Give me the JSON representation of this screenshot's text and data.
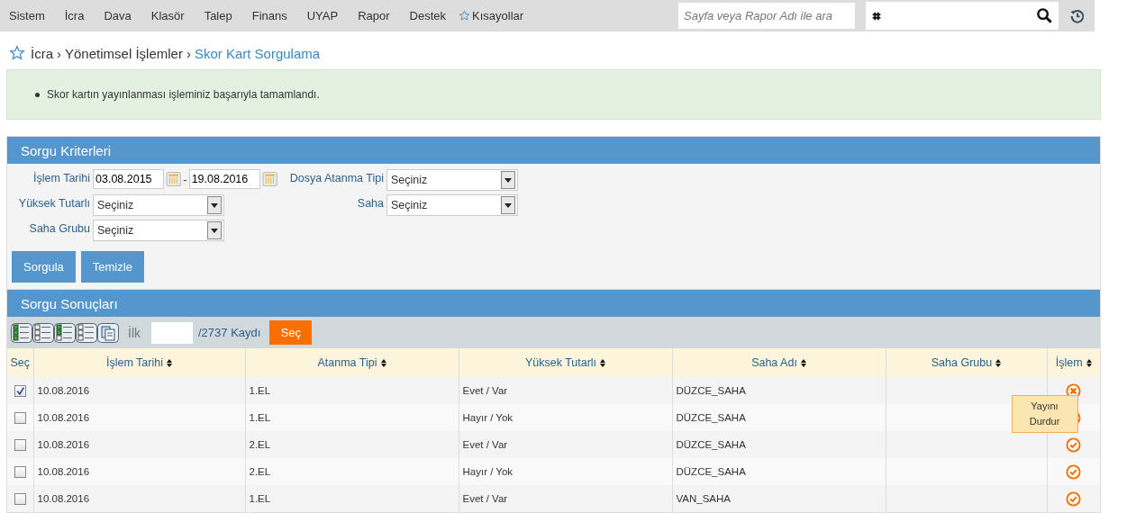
{
  "menu": {
    "items": [
      "Sistem",
      "İcra",
      "Dava",
      "Klasör",
      "Talep",
      "Finans",
      "UYAP",
      "Rapor",
      "Destek"
    ],
    "shortcuts": "Kısayollar",
    "page_search": {
      "placeholder": "Sayfa veya Rapor Adı ile ara"
    }
  },
  "breadcrumb": [
    {
      "kind": "link",
      "label": "İcra"
    },
    {
      "kind": "sep",
      "label": "›"
    },
    {
      "kind": "link",
      "label": "Yönetimsel İşlemler"
    },
    {
      "kind": "sep",
      "label": "›"
    },
    {
      "kind": "current",
      "label": "Skor Kart Sorgulama"
    }
  ],
  "alert": {
    "messages": [
      "Skor kartın yayınlanması işleminiz başarıyla tamamlandı."
    ]
  },
  "criteria": {
    "title": "Sorgu Kriterleri",
    "date": {
      "label": "İşlem Tarihi",
      "from": "03.08.2015",
      "dash": "-",
      "to": "19.08.2016"
    },
    "selects": [
      {
        "label": "Dosya Atanma Tipi",
        "value": "Seçiniz"
      },
      {
        "label": "Yüksek Tutarlı",
        "value": "Seçiniz"
      },
      {
        "label": "Saha",
        "value": "Seçiniz"
      },
      {
        "label": "Saha Grubu",
        "value": "Seçiniz"
      }
    ],
    "buttons": [
      "Sorgula",
      "Temizle"
    ]
  },
  "results": {
    "title": "Sorgu Sonuçları",
    "first_label": "İlk",
    "total": "/2737 Kaydı",
    "select_button": "Seç",
    "select_header": "Seç",
    "columns": [
      {
        "label": "İşlem Tarihi",
        "sortable": true
      },
      {
        "label": "Atanma Tipi",
        "sortable": true
      },
      {
        "label": "Yüksek Tutarlı",
        "sortable": true
      },
      {
        "label": "Saha Adı",
        "sortable": true
      },
      {
        "label": "Saha Grubu",
        "sortable": true
      },
      {
        "label": "İşlem",
        "sortable": true
      }
    ],
    "rows": [
      {
        "selected": true,
        "cells": [
          "10.08.2016",
          "1.EL",
          "Evet / Var",
          "DÜZCE_SAHA",
          ""
        ],
        "kind": "stop"
      },
      {
        "selected": false,
        "cells": [
          "10.08.2016",
          "1.EL",
          "Hayır / Yok",
          "DÜZCE_SAHA",
          ""
        ],
        "kind": "publish"
      },
      {
        "selected": false,
        "cells": [
          "10.08.2016",
          "2.EL",
          "Evet / Var",
          "DÜZCE_SAHA",
          ""
        ],
        "kind": "publish"
      },
      {
        "selected": false,
        "cells": [
          "10.08.2016",
          "2.EL",
          "Hayır / Yok",
          "DÜZCE_SAHA",
          ""
        ],
        "kind": "publish"
      },
      {
        "selected": false,
        "cells": [
          "10.08.2016",
          "1.EL",
          "Evet / Var",
          "VAN_SAHA",
          ""
        ],
        "kind": "publish"
      }
    ],
    "tooltip": "Yayını Durdur"
  }
}
